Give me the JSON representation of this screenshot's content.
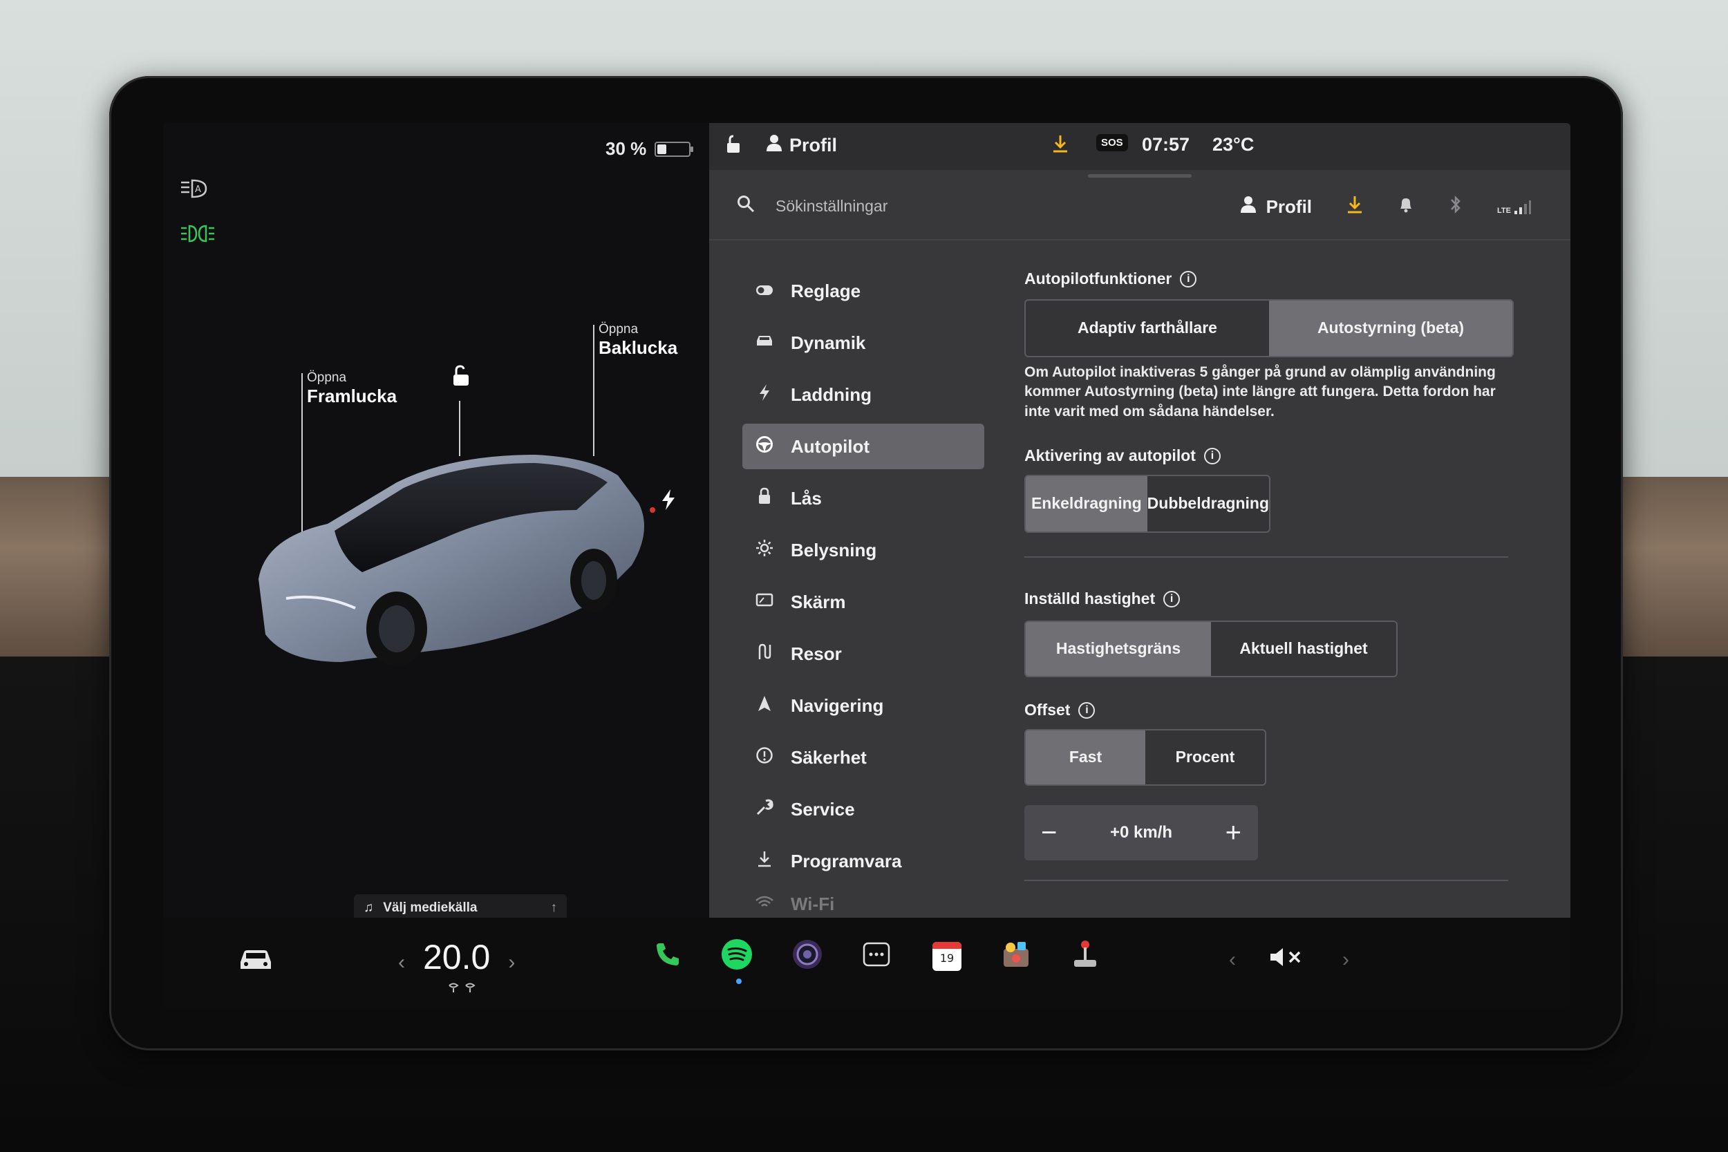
{
  "status": {
    "battery_text": "30 %",
    "battery_level": 0.3,
    "profile_label": "Profil",
    "sos_label": "SOS",
    "time": "07:57",
    "outside_temp": "23°C"
  },
  "car": {
    "frunk_small": "Öppna",
    "frunk_big": "Framlucka",
    "trunk_small": "Öppna",
    "trunk_big": "Baklucka",
    "media_label": "Välj mediekälla"
  },
  "search": {
    "placeholder": "Sökinställningar",
    "profile_label": "Profil",
    "network_label": "LTE"
  },
  "menu": {
    "items": [
      {
        "label": "Reglage",
        "icon": "toggle-icon"
      },
      {
        "label": "Dynamik",
        "icon": "car-front-icon"
      },
      {
        "label": "Laddning",
        "icon": "bolt-icon"
      },
      {
        "label": "Autopilot",
        "icon": "steering-wheel-icon"
      },
      {
        "label": "Lås",
        "icon": "lock-icon"
      },
      {
        "label": "Belysning",
        "icon": "sun-icon"
      },
      {
        "label": "Skärm",
        "icon": "display-icon"
      },
      {
        "label": "Resor",
        "icon": "route-icon"
      },
      {
        "label": "Navigering",
        "icon": "navigation-icon"
      },
      {
        "label": "Säkerhet",
        "icon": "info-circle-icon"
      },
      {
        "label": "Service",
        "icon": "wrench-icon"
      },
      {
        "label": "Programvara",
        "icon": "download-icon"
      },
      {
        "label": "Wi-Fi",
        "icon": "wifi-icon"
      }
    ]
  },
  "autopilot": {
    "features_title": "Autopilotfunktioner",
    "features_options": [
      "Adaptiv farthållare",
      "Autostyrning (beta)"
    ],
    "features_selected": 1,
    "description": "Om Autopilot inaktiveras 5 gånger på grund av olämplig användning kommer Autostyrning (beta) inte längre att fungera. Detta fordon har inte varit med om sådana händelser.",
    "activation_title": "Aktivering av autopilot",
    "activation_options": [
      "Enkeldragning",
      "Dubbeldragning"
    ],
    "activation_selected": 0,
    "speed_title": "Inställd hastighet",
    "speed_options": [
      "Hastighetsgräns",
      "Aktuell hastighet"
    ],
    "speed_selected": 0,
    "offset_title": "Offset",
    "offset_options": [
      "Fast",
      "Procent"
    ],
    "offset_selected": 0,
    "offset_value": "+0 km/h",
    "minus": "−",
    "plus": "+"
  },
  "bottom": {
    "cabin_temp": "20.0",
    "calendar_day": "19",
    "chevron_left": "‹",
    "chevron_right": "›"
  },
  "colors": {
    "accent_green": "#35c759",
    "download_yellow": "#f5b81c",
    "spotify_green": "#1ed760"
  }
}
